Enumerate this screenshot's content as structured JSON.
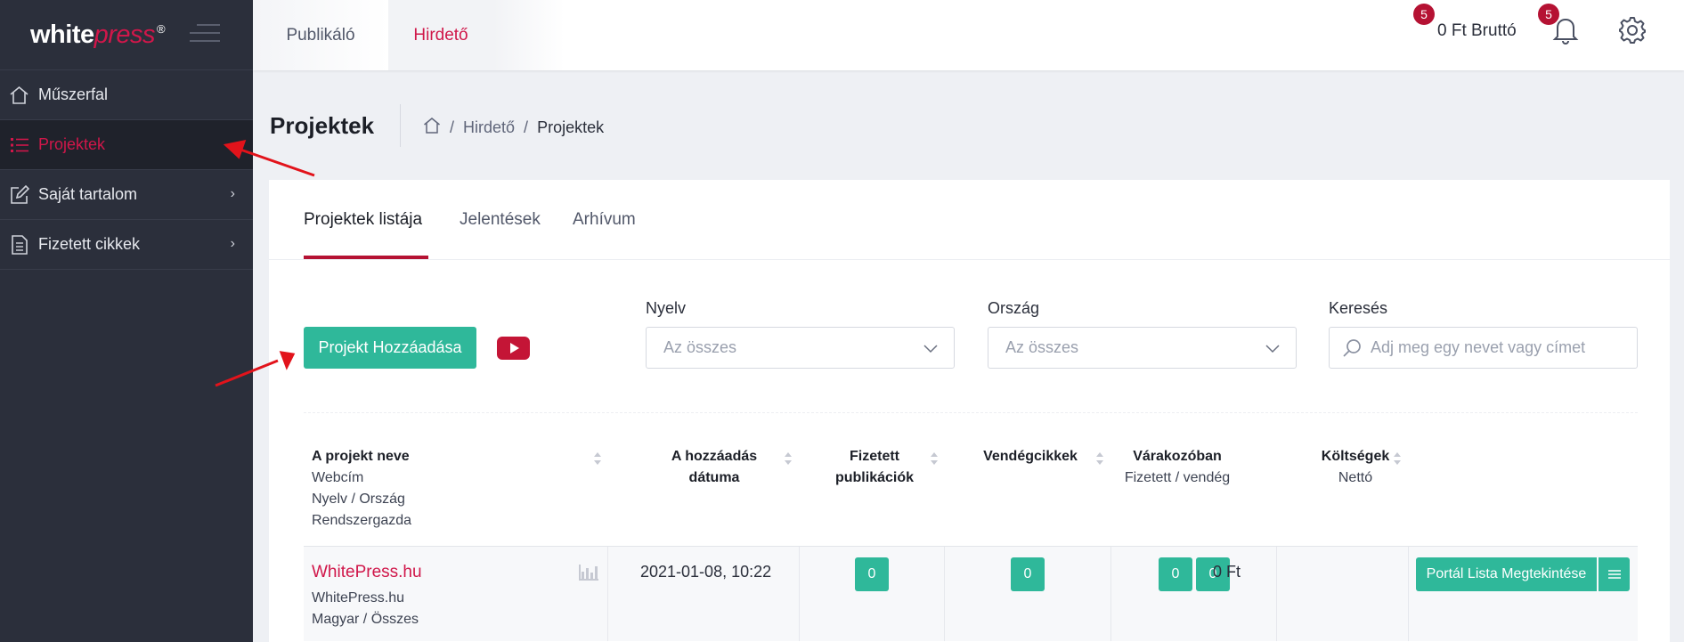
{
  "logo": {
    "main": "white",
    "accent": "press",
    "mark": "®"
  },
  "sidebar": {
    "items": [
      {
        "label": "Műszerfal",
        "icon": "home-icon"
      },
      {
        "label": "Projektek",
        "icon": "list-icon",
        "active": true
      },
      {
        "label": "Saját tartalom",
        "icon": "edit-icon",
        "chevron": "›"
      },
      {
        "label": "Fizetett cikkek",
        "icon": "document-icon",
        "chevron": "›"
      }
    ]
  },
  "topbar": {
    "tabs": [
      "Publikáló",
      "Hirdető"
    ],
    "balance": "0 Ft Bruttó",
    "balance_badge": "5",
    "notifications_badge": "5"
  },
  "page": {
    "title": "Projektek",
    "breadcrumb": [
      "Hirdető",
      "Projektek"
    ],
    "breadcrumb_sep": "/"
  },
  "tabs": [
    "Projektek listája",
    "Jelentések",
    "Arhívum"
  ],
  "toolbar": {
    "add_label": "Projekt Hozzáadása"
  },
  "filters": {
    "language": {
      "label": "Nyelv",
      "value": "Az összes"
    },
    "country": {
      "label": "Ország",
      "value": "Az összes"
    },
    "search": {
      "label": "Keresés",
      "placeholder": "Adj meg egy nevet vagy címet"
    }
  },
  "table": {
    "headers": {
      "name": {
        "title": "A projekt neve",
        "sub": [
          "Webcím",
          "Nyelv / Ország",
          "Rendszergazda"
        ]
      },
      "date": {
        "title": [
          "A hozzáadás",
          "dátuma"
        ]
      },
      "paid": {
        "title": [
          "Fizetett",
          "publikációk"
        ]
      },
      "guest": {
        "title": "Vendégcikkek"
      },
      "pending": {
        "title": "Várakozóban",
        "sub": "Fizetett / vendég"
      },
      "costs": {
        "title": "Költségek",
        "sub": "Nettó"
      }
    },
    "rows": [
      {
        "name": "WhitePress.hu",
        "url": "WhitePress.hu",
        "lang_country": "Magyar / Összes",
        "date": "2021-01-08, 10:22",
        "paid": "0",
        "guest": "0",
        "pending_paid": "0",
        "pending_guest": "0",
        "cost": "0 Ft",
        "action": "Portál Lista Megtekintése"
      }
    ]
  },
  "colors": {
    "accent": "#d0174a",
    "primary": "#2fb89a",
    "sidebar": "#2b2f3b",
    "badge": "#b51233"
  }
}
